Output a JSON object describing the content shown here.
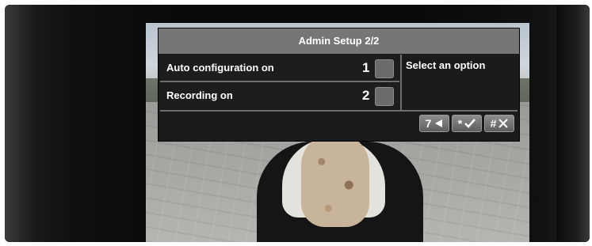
{
  "menu": {
    "title": "Admin Setup 2/2",
    "options": [
      {
        "label": "Auto configuration on",
        "key": "1"
      },
      {
        "label": "Recording on",
        "key": "2"
      }
    ],
    "hint": "Select an option",
    "soft_keys": [
      {
        "key": "7",
        "icon": "back-arrow-icon"
      },
      {
        "key": "*",
        "icon": "checkmark-icon"
      },
      {
        "key": "#",
        "icon": "cancel-x-icon"
      }
    ]
  }
}
